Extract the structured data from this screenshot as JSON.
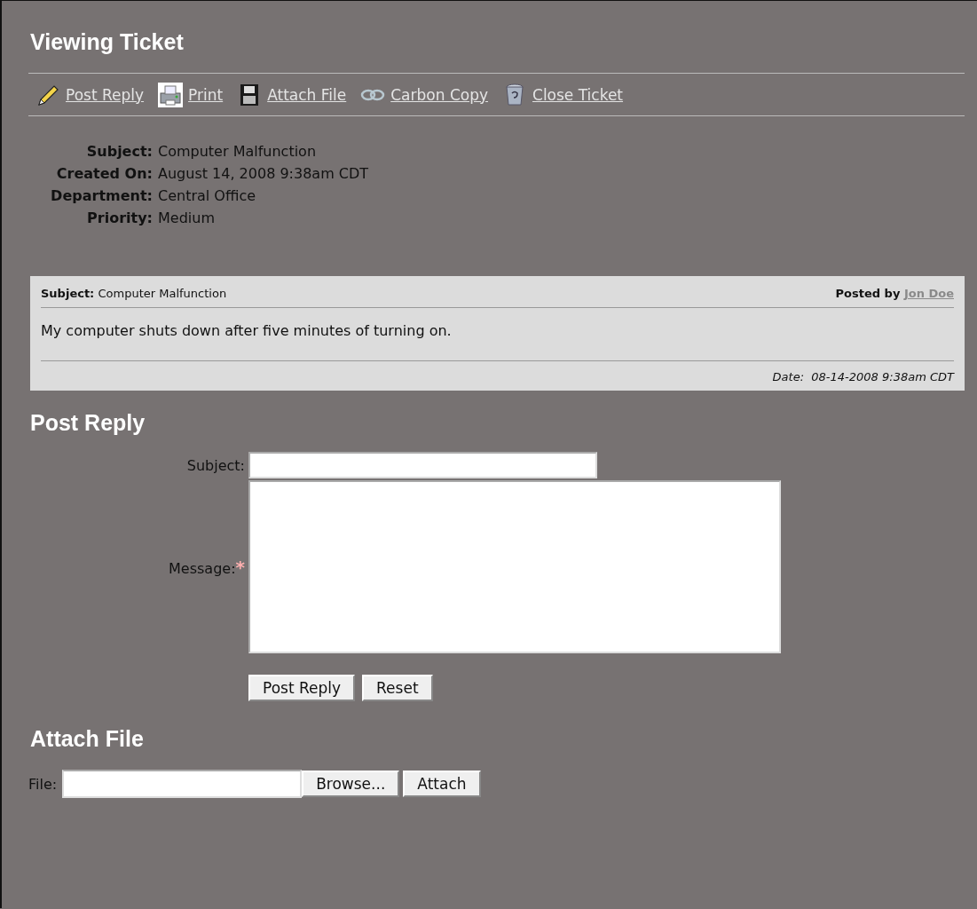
{
  "page_title": "Viewing Ticket",
  "toolbar": [
    {
      "label": "Post Reply"
    },
    {
      "label": "Print"
    },
    {
      "label": "Attach File"
    },
    {
      "label": "Carbon Copy"
    },
    {
      "label": "Close Ticket"
    }
  ],
  "details": [
    {
      "label": "Subject:",
      "value": "Computer Malfunction"
    },
    {
      "label": "Created On:",
      "value": "August 14, 2008 9:38am CDT"
    },
    {
      "label": "Department:",
      "value": "Central Office"
    },
    {
      "label": "Priority:",
      "value": "Medium"
    }
  ],
  "message": {
    "subject_label": "Subject:",
    "subject": "Computer Malfunction",
    "posted_by_label": "Posted by",
    "author": "Jon Doe",
    "body": "My computer shuts down after five minutes of turning on.",
    "date": "Date:  08-14-2008 9:38am CDT"
  },
  "reply_form": {
    "heading": "Post Reply",
    "fields": [
      {
        "label": "Subject:",
        "kind": "text"
      },
      {
        "label": "Message:",
        "kind": "textarea",
        "required_mark": "*"
      }
    ],
    "buttons": [
      "Post Reply",
      "Reset"
    ]
  },
  "attach": {
    "heading": "Attach File",
    "label": "File:",
    "browse_button": "Browse...",
    "attach_button": "Attach"
  }
}
